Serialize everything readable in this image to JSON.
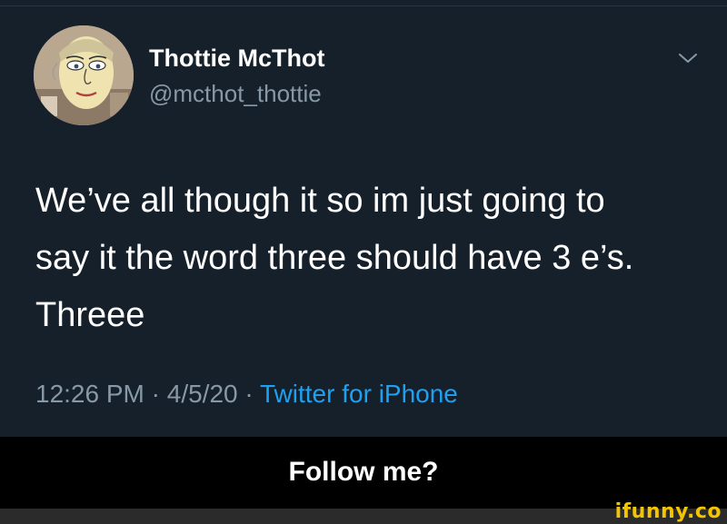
{
  "tweet": {
    "author_name": "Thottie McThot",
    "author_handle": "@mcthot_thottie",
    "text_lines": [
      "We’ve all though it so im just going to",
      "say it the word three should have 3 e’s.",
      "Threee"
    ],
    "time": "12:26 PM",
    "separator": " · ",
    "date": "4/5/20",
    "source": "Twitter for iPhone",
    "menu_icon": "chevron-down-icon",
    "avatar_icon": "profile-avatar"
  },
  "caption": {
    "text": "Follow me?"
  },
  "watermark": {
    "text": "ifunny.co"
  },
  "colors": {
    "tweet_background": "#15202b",
    "secondary_text": "#8899a6",
    "link": "#1da1f2",
    "watermark": "#f5c400"
  }
}
